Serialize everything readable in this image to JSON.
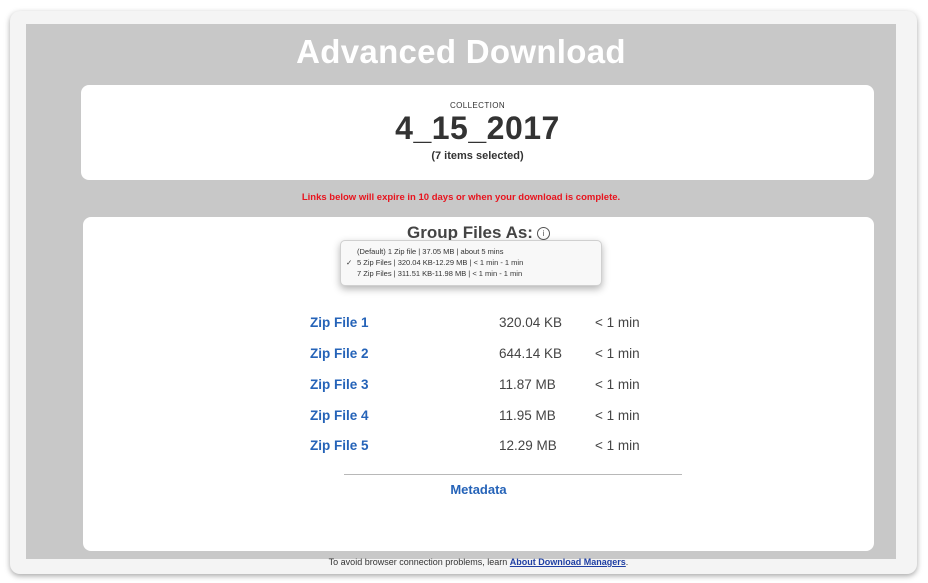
{
  "header": {
    "title": "Advanced Download"
  },
  "collection": {
    "label": "COLLECTION",
    "name": "4_15_2017",
    "selected_count": "(7 items selected)"
  },
  "expiry_notice": "Links below will expire in 10 days or when your download is complete.",
  "group_files": {
    "heading": "Group Files As:",
    "info_icon": "i",
    "options": [
      {
        "label": "(Default) 1 Zip file | 37.05 MB | about 5 mins",
        "selected": false
      },
      {
        "label": "5 Zip Files | 320.04 KB-12.29 MB | < 1 min - 1 min",
        "selected": true,
        "check": "✓"
      },
      {
        "label": "7 Zip Files | 311.51 KB-11.98 MB | < 1 min - 1 min",
        "selected": false
      }
    ]
  },
  "files": [
    {
      "name": "Zip File 1",
      "size": "320.04 KB",
      "time": "< 1 min"
    },
    {
      "name": "Zip File 2",
      "size": "644.14 KB",
      "time": "< 1 min"
    },
    {
      "name": "Zip File 3",
      "size": "11.87 MB",
      "time": "< 1 min"
    },
    {
      "name": "Zip File 4",
      "size": "11.95 MB",
      "time": "< 1 min"
    },
    {
      "name": "Zip File 5",
      "size": "12.29 MB",
      "time": "< 1 min"
    }
  ],
  "metadata_link": "Metadata",
  "footer": {
    "text": "To avoid browser connection problems, learn ",
    "link": "About Download Managers",
    "suffix": "."
  },
  "colors": {
    "panel_gray": "#c8c8c8",
    "link_blue": "#2563b8",
    "warning_red": "#e8141e"
  }
}
